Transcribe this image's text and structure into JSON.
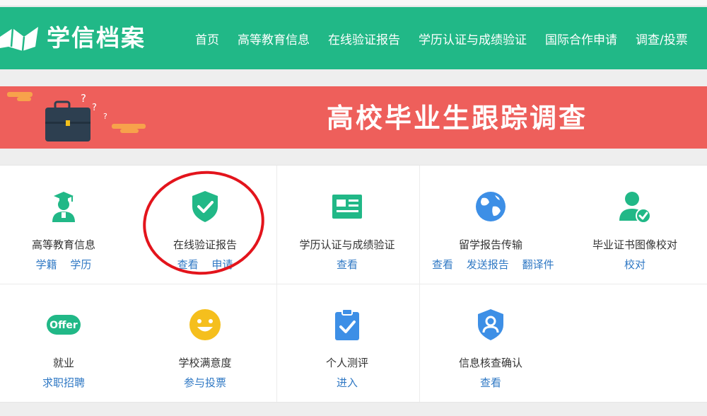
{
  "header": {
    "logo_text": "学信档案",
    "nav": [
      "首页",
      "高等教育信息",
      "在线验证报告",
      "学历认证与成绩验证",
      "国际合作申请",
      "调查/投票"
    ]
  },
  "banner": {
    "title": "高校毕业生跟踪调查"
  },
  "colors": {
    "brand_green": "#21b887",
    "banner_red": "#ee5f5b",
    "link_blue": "#2f78c4",
    "annotation_red": "#e3141c"
  },
  "tiles": [
    {
      "icon": "graduate-icon",
      "title": "高等教育信息",
      "links": [
        "学籍",
        "学历"
      ]
    },
    {
      "icon": "shield-check-icon",
      "title": "在线验证报告",
      "links": [
        "查看",
        "申请"
      ]
    },
    {
      "icon": "certificate-card-icon",
      "title": "学历认证与成绩验证",
      "links": [
        "查看"
      ]
    },
    {
      "icon": "globe-icon",
      "title": "留学报告传输",
      "links": [
        "查看",
        "发送报告",
        "翻译件"
      ]
    },
    {
      "icon": "user-verified-icon",
      "title": "毕业证书图像校对",
      "links": [
        "校对"
      ]
    },
    {
      "icon": "offer-icon",
      "title": "就业",
      "links": [
        "求职招聘"
      ],
      "badge": "Offer"
    },
    {
      "icon": "smiley-icon",
      "title": "学校满意度",
      "links": [
        "参与投票"
      ]
    },
    {
      "icon": "clipboard-check-icon",
      "title": "个人测评",
      "links": [
        "进入"
      ]
    },
    {
      "icon": "shield-user-icon",
      "title": "信息核查确认",
      "links": [
        "查看"
      ]
    }
  ]
}
